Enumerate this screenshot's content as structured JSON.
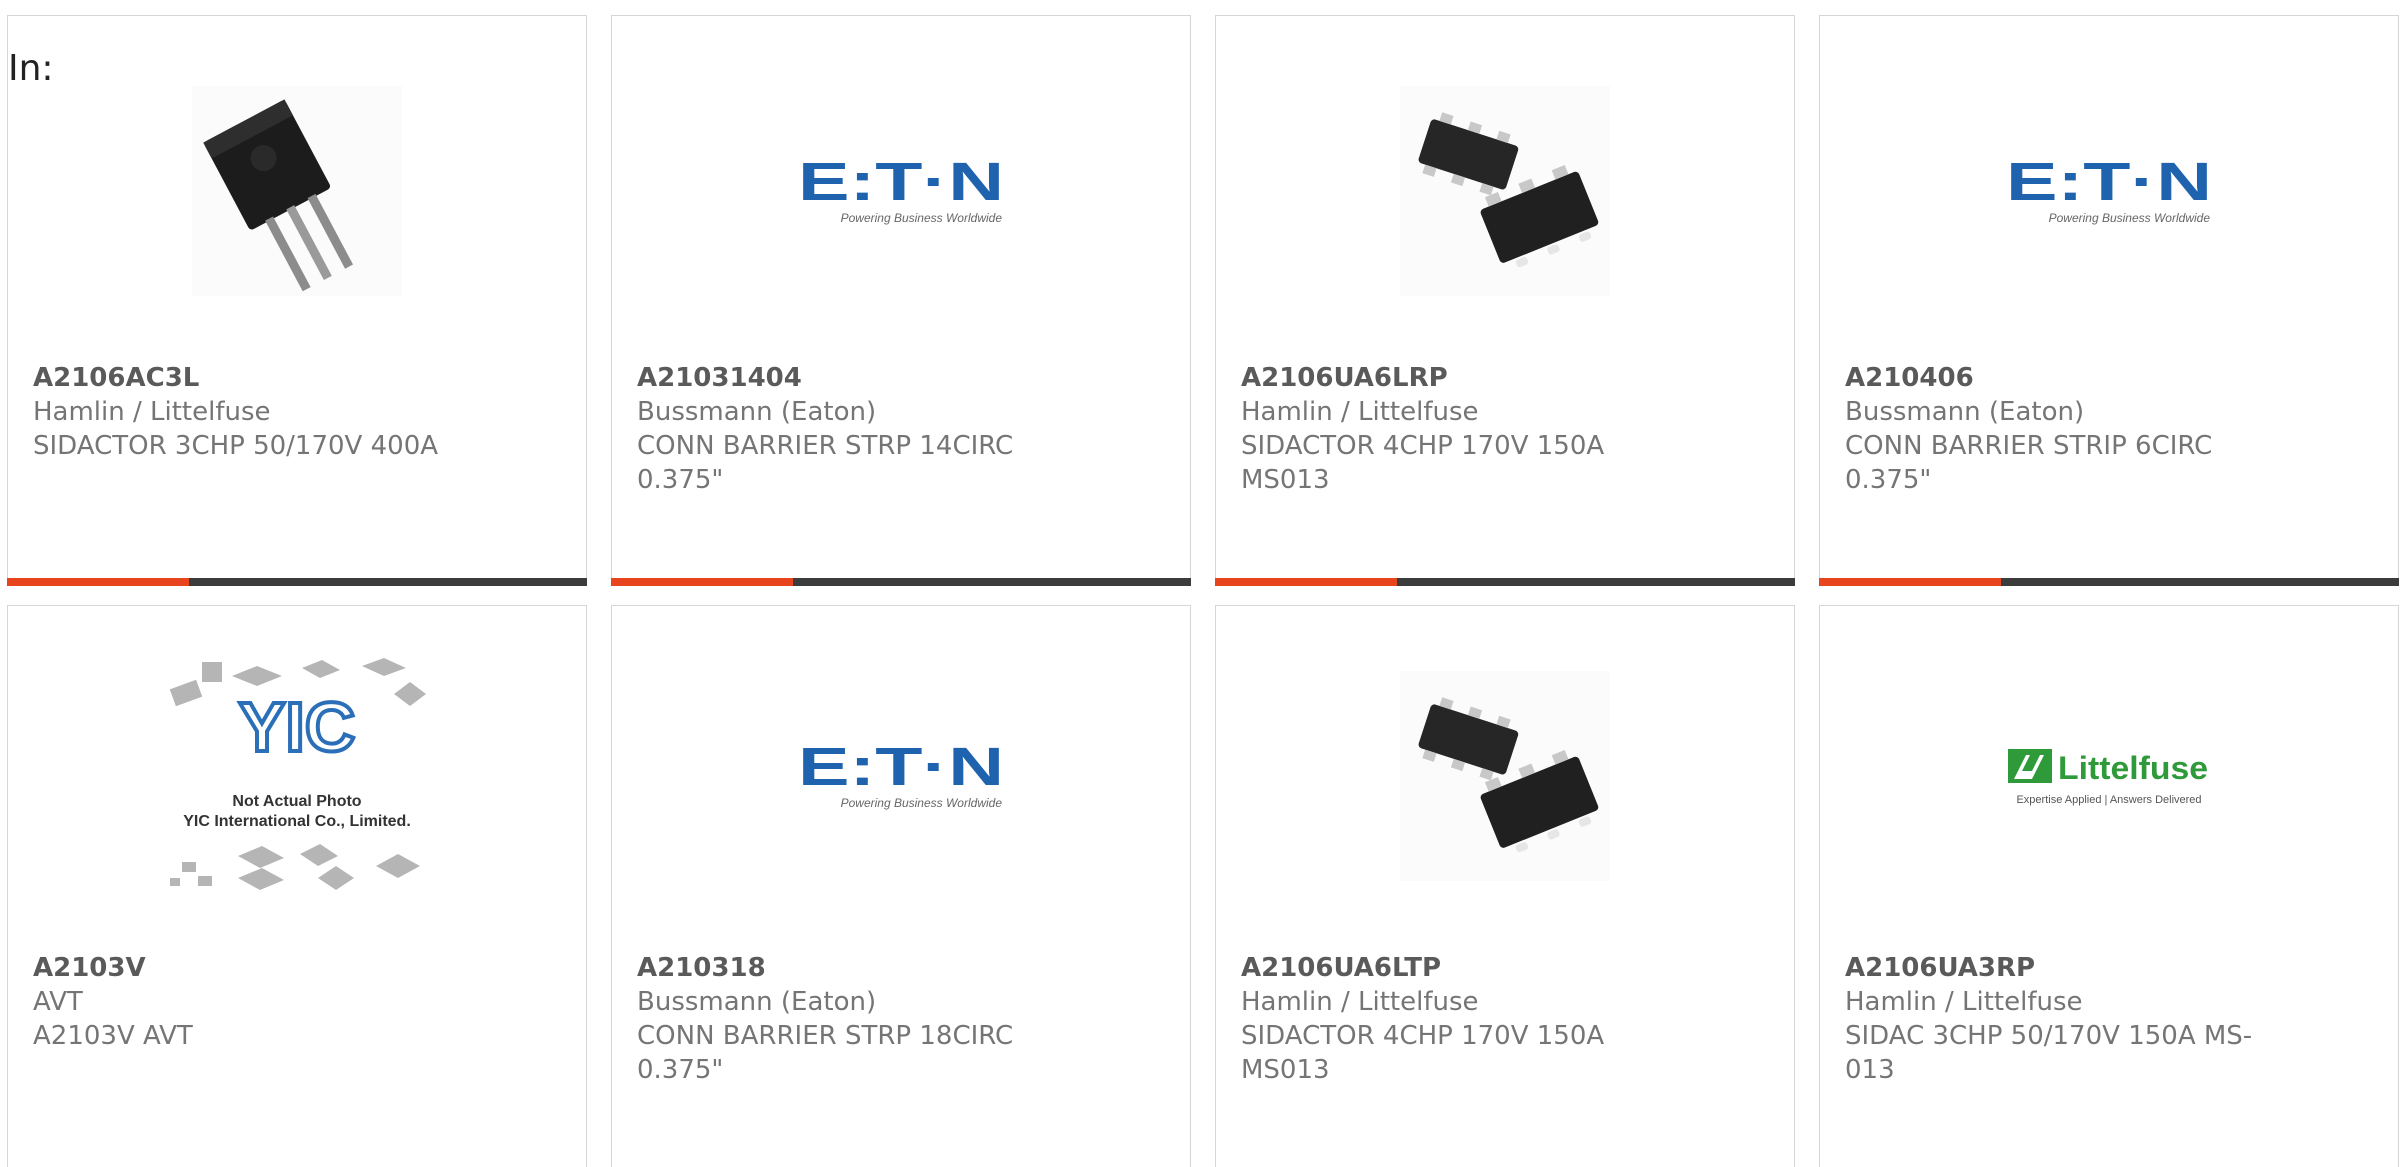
{
  "filter_label": "In:",
  "colors": {
    "accent": "#e8451e",
    "bar": "#3c3c3c",
    "eaton_blue": "#1f63ae",
    "littelfuse_green": "#2e9a3a"
  },
  "products": [
    {
      "part": "A2106AC3L",
      "maker": "Hamlin / Littelfuse",
      "desc": "SIDACTOR 3CHP 50/170V 400A",
      "image": "to-package-icon"
    },
    {
      "part": "A21031404",
      "maker": "Bussmann (Eaton)",
      "desc": "CONN BARRIER STRP 14CIRC 0.375\"",
      "image": "eaton-logo",
      "logo_tagline": "Powering Business Worldwide"
    },
    {
      "part": "A2106UA6LRP",
      "maker": "Hamlin / Littelfuse",
      "desc": "SIDACTOR 4CHP 170V 150A MS013",
      "image": "smd-package-icon"
    },
    {
      "part": "A210406",
      "maker": "Bussmann (Eaton)",
      "desc": "CONN BARRIER STRIP 6CIRC 0.375\"",
      "image": "eaton-logo",
      "logo_tagline": "Powering Business Worldwide"
    },
    {
      "part": "A2103V",
      "maker": "AVT",
      "desc": "A2103V AVT",
      "image": "yic-placeholder",
      "logo_lines": [
        "Not Actual Photo",
        "YIC International Co., Limited."
      ]
    },
    {
      "part": "A210318",
      "maker": "Bussmann (Eaton)",
      "desc": "CONN BARRIER STRP 18CIRC 0.375\"",
      "image": "eaton-logo",
      "logo_tagline": "Powering Business Worldwide"
    },
    {
      "part": "A2106UA6LTP",
      "maker": "Hamlin / Littelfuse",
      "desc": "SIDACTOR 4CHP 170V 150A MS013",
      "image": "smd-package-icon"
    },
    {
      "part": "A2106UA3RP",
      "maker": "Hamlin / Littelfuse",
      "desc": "SIDAC 3CHP 50/170V 150A MS-013",
      "image": "littelfuse-logo",
      "logo_tagline": "Expertise Applied | Answers Delivered"
    }
  ]
}
